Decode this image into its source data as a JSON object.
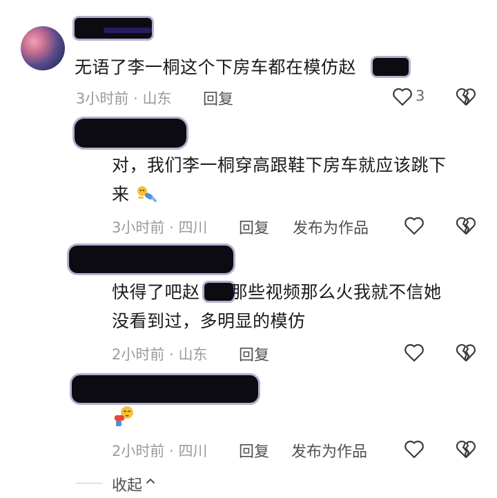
{
  "comments": [
    {
      "text_lines": [
        "无语了李一桐这个下房车都在模仿赵"
      ],
      "time": "3小时前",
      "location": "山东",
      "reply_label": "回复",
      "like_count": "3"
    },
    {
      "text_lines": [
        "对，我们李一桐穿高跟鞋下房车就应该跳下",
        "来"
      ],
      "time": "3小时前",
      "location": "四川",
      "reply_label": "回复",
      "publish_label": "发布为作品"
    },
    {
      "text_lines": [
        "快得了吧赵",
        "那些视频那么火我就不信她",
        "没看到过，多明显的模仿"
      ],
      "time": "2小时前",
      "location": "山东",
      "reply_label": "回复"
    },
    {
      "time": "2小时前",
      "location": "四川",
      "reply_label": "回复",
      "publish_label": "发布为作品"
    }
  ],
  "meta_separator": "·",
  "collapse_label": "收起",
  "icons": {
    "like": "heart-outline-icon",
    "dislike": "broken-heart-icon",
    "collapse": "chevron-up-icon"
  },
  "colors": {
    "text": "#1a1a1a",
    "meta": "#9a9a9a",
    "icon": "#3a3a3a",
    "redaction": "#0c0b12"
  }
}
